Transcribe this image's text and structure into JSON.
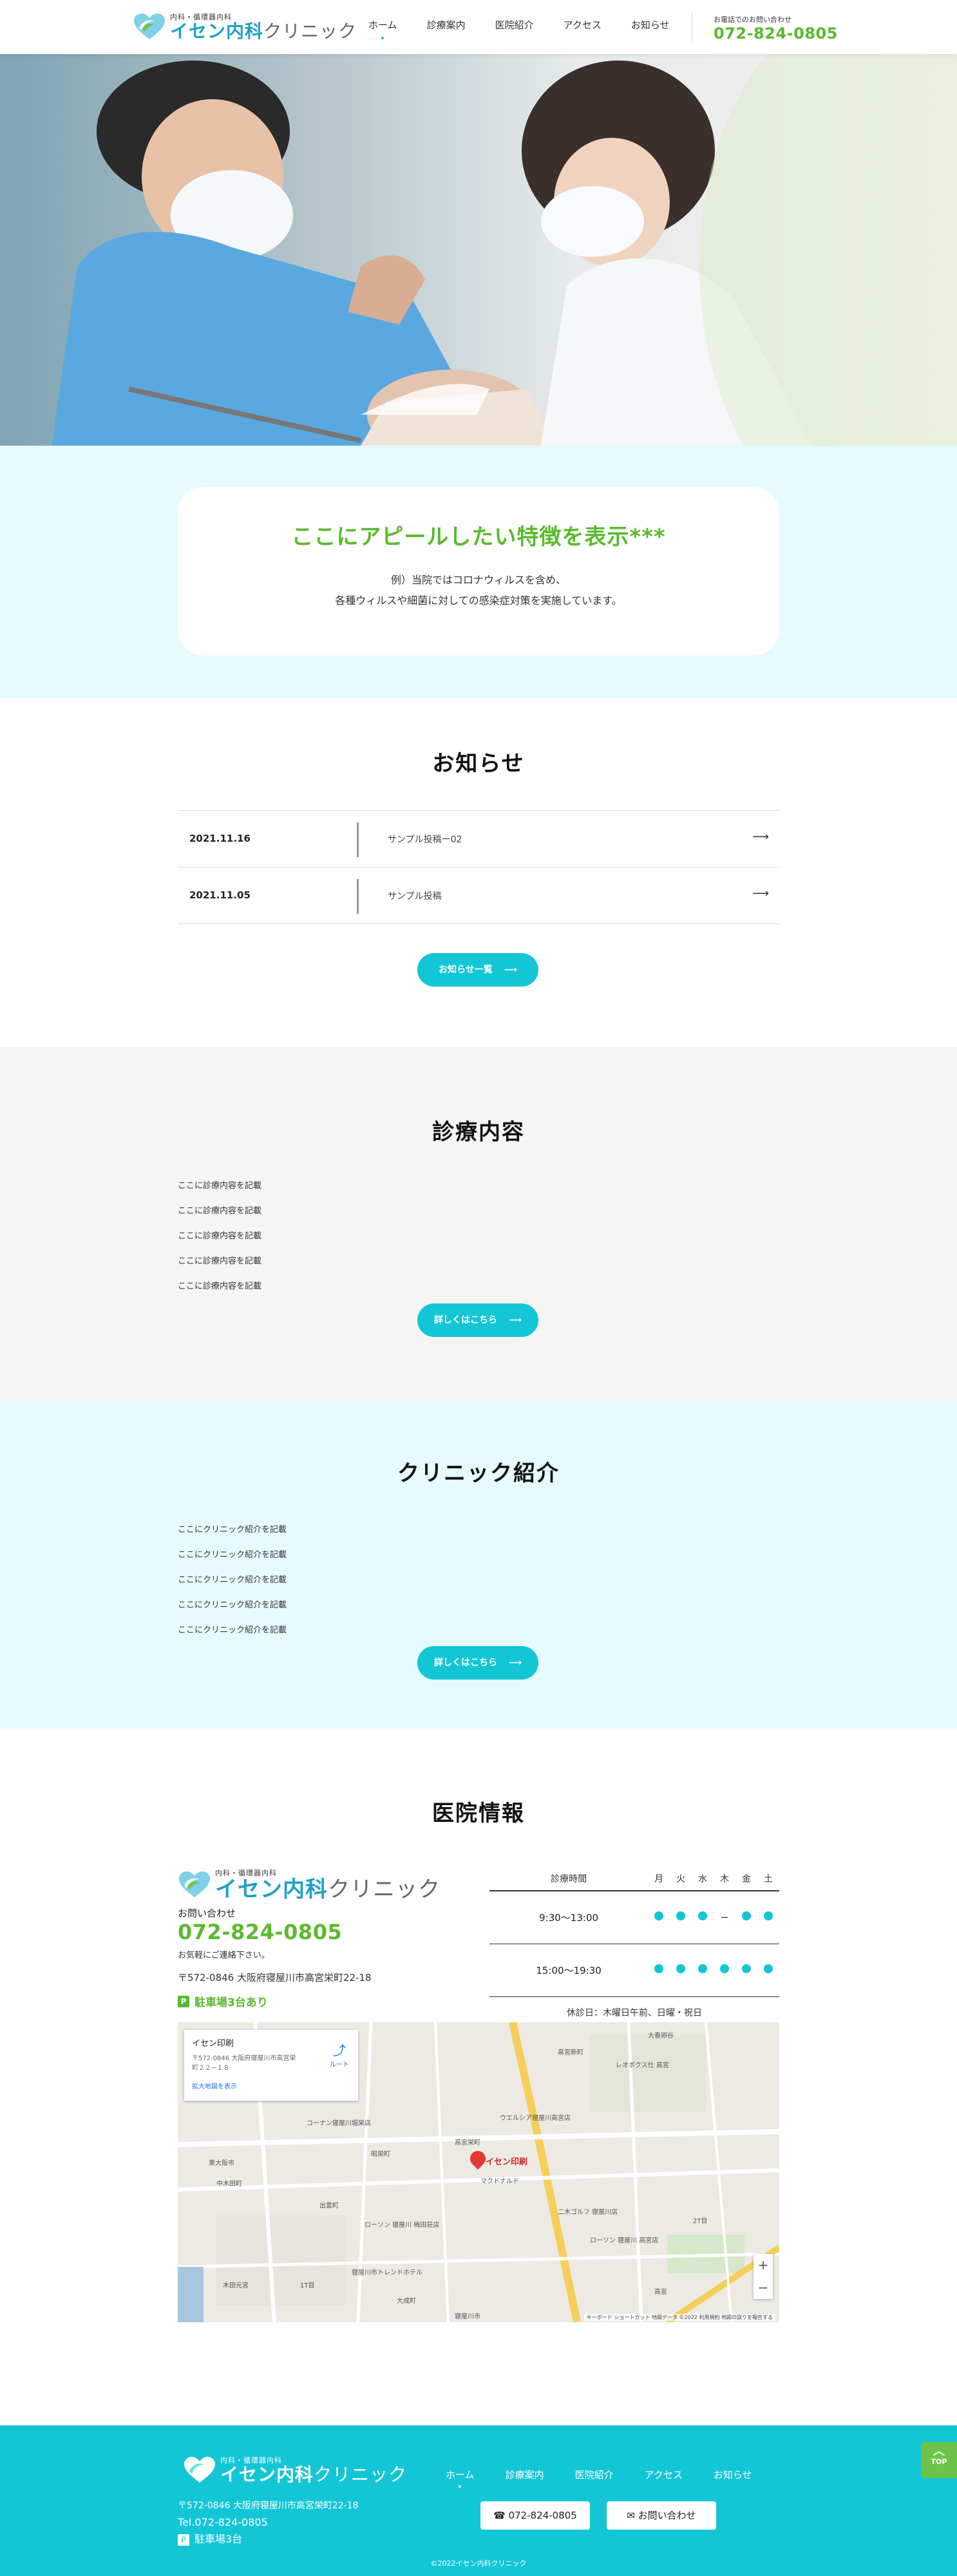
{
  "header": {
    "logo_sub": "内科・循環器内科",
    "logo_brand": "イセン内科",
    "logo_rest": "クリニック",
    "nav": [
      {
        "label": "ホーム",
        "active": true
      },
      {
        "label": "診療案内"
      },
      {
        "label": "医院紹介"
      },
      {
        "label": "アクセス"
      },
      {
        "label": "お知らせ"
      }
    ],
    "tel_label": "お電話でのお問い合わせ",
    "tel": "072-824-0805"
  },
  "appeal": {
    "title": "ここにアピールしたい特徴を表示***",
    "line1": "例）当院ではコロナウィルスを含め、",
    "line2": "各種ウィルスや細菌に対しての感染症対策を実施しています。"
  },
  "news": {
    "title": "お知らせ",
    "items": [
      {
        "date": "2021.11.16",
        "title": "サンプル投稿ー02"
      },
      {
        "date": "2021.11.05",
        "title": "サンプル投稿"
      }
    ],
    "button": "お知らせ一覧"
  },
  "services": {
    "title": "診療内容",
    "items": [
      "ここに診療内容を記載",
      "ここに診療内容を記載",
      "ここに診療内容を記載",
      "ここに診療内容を記載",
      "ここに診療内容を記載"
    ],
    "button": "詳しくはこちら"
  },
  "clinic": {
    "title": "クリニック紹介",
    "items": [
      "ここにクリニック紹介を記載",
      "ここにクリニック紹介を記載",
      "ここにクリニック紹介を記載",
      "ここにクリニック紹介を記載",
      "ここにクリニック紹介を記載"
    ],
    "button": "詳しくはこちら"
  },
  "info": {
    "title": "医院情報",
    "contact_label": "お問い合わせ",
    "tel": "072-824-0805",
    "tel_note": "お気軽にご連絡下さい。",
    "address": "〒572-0846 大阪府寝屋川市高宮栄町22-18",
    "parking": "駐車場3台あり",
    "schedule": {
      "headers": [
        "診療時間",
        "月",
        "火",
        "水",
        "木",
        "金",
        "土"
      ],
      "rows": [
        {
          "time": "9:30〜13:00",
          "days": [
            "●",
            "●",
            "●",
            "−",
            "●",
            "●"
          ]
        },
        {
          "time": "15:00〜19:30",
          "days": [
            "●",
            "●",
            "●",
            "●",
            "●",
            "●"
          ]
        }
      ],
      "note": "休診日：木曜日午前、日曜・祝日"
    },
    "map": {
      "place_name": "イセン印刷",
      "place_address": "〒572-0846 大阪府寝屋川市高宮栄町２２−１８",
      "enlarge_link": "拡大地図を表示",
      "route_label": "ルート",
      "pin_label": "イセン印刷",
      "zoom_in": "+",
      "zoom_out": "−",
      "footer": "キーボード ショートカット  地図データ ©2022  利用規約  地図の誤りを報告する",
      "labels": [
        "高宮新町",
        "レオボクス仕 高宮",
        "大春卵谷",
        "コーナン寝屋川堀栄店",
        "ウエルシア寝屋川高宮店",
        "高宮栄町",
        "昭栄町",
        "東大阪市",
        "マクドナルド",
        "中木田町",
        "出雲町",
        "ローソン 寝屋川 梅田荘店",
        "二木ゴルフ 寝屋川店",
        "寝屋川市トレンドホテル",
        "ローソン 寝屋川 高宮店",
        "木田元宮",
        "大成町",
        "寝屋川市",
        "高宮",
        "1T目",
        "2T目"
      ]
    }
  },
  "footer": {
    "logo_sub": "内科・循環器内科",
    "logo_brand": "イセン内科",
    "logo_rest": "クリニック",
    "address": "〒572-0846 大阪府寝屋川市高宮栄町22-18",
    "tel": "Tel.072-824-0805",
    "parking": "駐車場3台",
    "nav": [
      {
        "label": "ホーム",
        "active": true
      },
      {
        "label": "診療案内"
      },
      {
        "label": "医院紹介"
      },
      {
        "label": "アクセス"
      },
      {
        "label": "お知らせ"
      }
    ],
    "tel_button": "072-824-0805",
    "contact_button": "お問い合わせ",
    "copyright": "©2022イセン内科クリニック",
    "top_button": "TOP"
  },
  "colors": {
    "accent": "#13c6d6",
    "green": "#5aba2e",
    "light_bg": "#e6fbfd"
  }
}
